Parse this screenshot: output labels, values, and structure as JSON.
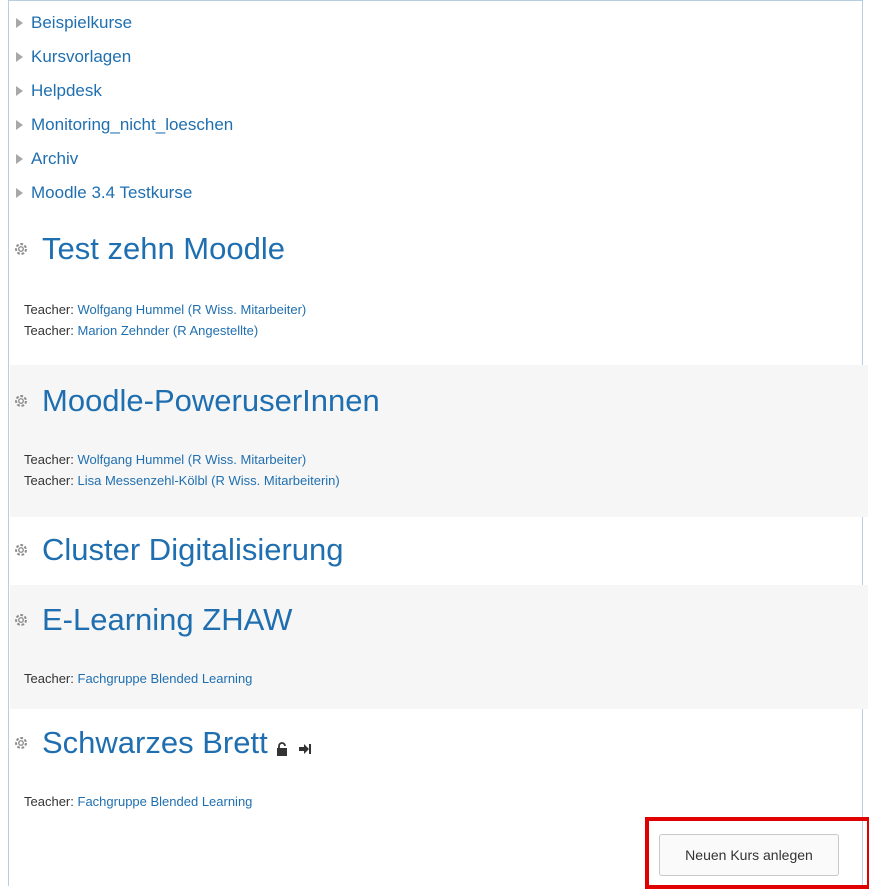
{
  "categories": [
    {
      "label": "Beispielkurse"
    },
    {
      "label": "Kursvorlagen"
    },
    {
      "label": "Helpdesk"
    },
    {
      "label": "Monitoring_nicht_loeschen"
    },
    {
      "label": "Archiv"
    },
    {
      "label": "Moodle 3.4 Testkurse"
    }
  ],
  "courses": [
    {
      "title": "Test zehn Moodle",
      "teachers": [
        {
          "role": "Teacher:",
          "name": "Wolfgang Hummel (R Wiss. Mitarbeiter)"
        },
        {
          "role": "Teacher:",
          "name": "Marion Zehnder (R Angestellte)"
        }
      ]
    },
    {
      "title": "Moodle-PoweruserInnen",
      "teachers": [
        {
          "role": "Teacher:",
          "name": "Wolfgang Hummel (R Wiss. Mitarbeiter)"
        },
        {
          "role": "Teacher:",
          "name": "Lisa Messenzehl-Kölbl (R Wiss. Mitarbeiterin)"
        }
      ]
    },
    {
      "title": "Cluster Digitalisierung",
      "teachers": []
    },
    {
      "title": "E-Learning ZHAW",
      "teachers": [
        {
          "role": "Teacher:",
          "name": "Fachgruppe Blended Learning"
        }
      ]
    },
    {
      "title": "Schwarzes Brett",
      "teachers": [
        {
          "role": "Teacher:",
          "name": "Fachgruppe Blended Learning"
        }
      ]
    }
  ],
  "actions": {
    "new_course": "Neuen Kurs anlegen"
  },
  "colors": {
    "link": "#1f6fb0",
    "highlight": "#e00000",
    "stripe": "#f6f6f6"
  }
}
